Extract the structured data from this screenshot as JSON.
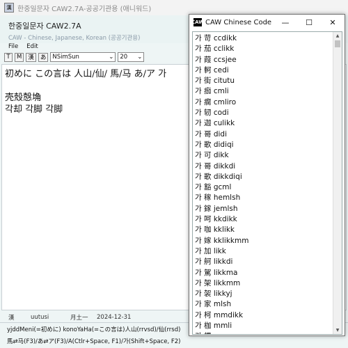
{
  "main_window": {
    "title": "한중일문자 CAW2.7A-공공기관용 (애니워드)",
    "heading": "한중일문자 CAW2.7A",
    "subheading": "CAW - Chinese, Japanese, Korean  (공공기관용)",
    "menu": [
      "File",
      "Edit"
    ],
    "toolbar": {
      "buttons": [
        "T",
        "M",
        "漢",
        "あ"
      ],
      "font_select": "NSimSun",
      "size_select": "20"
    },
    "editor_lines": [
      "初めに この言は 人山/仙/ 馬/马 あ/ア 가",
      "",
      "壳殼慤埆",
      "각却 각脚 각脚"
    ],
    "status": {
      "char": "漢",
      "code": "uutusi",
      "reading": "月土一",
      "date": "2024-12-31"
    },
    "hints": [
      "yjddMeni(=初めに) konoYaHa(=この言は)人山(rrvsd)/仙(rrsd)",
      "馬⇄马(F3)/あ⇄ア(F3)/A(Ctlr+Space, F1)/가(Shift+Space, F2)"
    ]
  },
  "code_window": {
    "title": "CAW Chinese Code",
    "icon": "caw-app-icon",
    "caption_buttons": [
      "minimize",
      "maximize",
      "close"
    ],
    "items": [
      "가 苛 ccdikk",
      "가 茄 cclikk",
      "가 葭 ccsjee",
      "가 軻 cedi",
      "가 街 citutu",
      "가 痂 cmli",
      "가 瘸 cmliro",
      "가 轫 codi",
      "가 迦 culikk",
      "가 哥 didi",
      "가 歌 didiqi",
      "가 可 dikk",
      "가 哥 dikkdi",
      "가 歌 dikkdiqi",
      "가 豁 gcml",
      "가 稼 hemlsh",
      "가 鎵 jemlsh",
      "가 呵 kkdikk",
      "가 咖 kklikk",
      "가 嫁 kklikkmm",
      "가 加 likk",
      "가 舸 likkdi",
      "가 駕 likkma",
      "가 架 likkmm",
      "가 袈 likkyj",
      "가 家 mlsh",
      "가 柯 mmdikk",
      "가 枷 mmli",
      "가 檟 mmye",
      "가 嫁 numlsh"
    ]
  }
}
